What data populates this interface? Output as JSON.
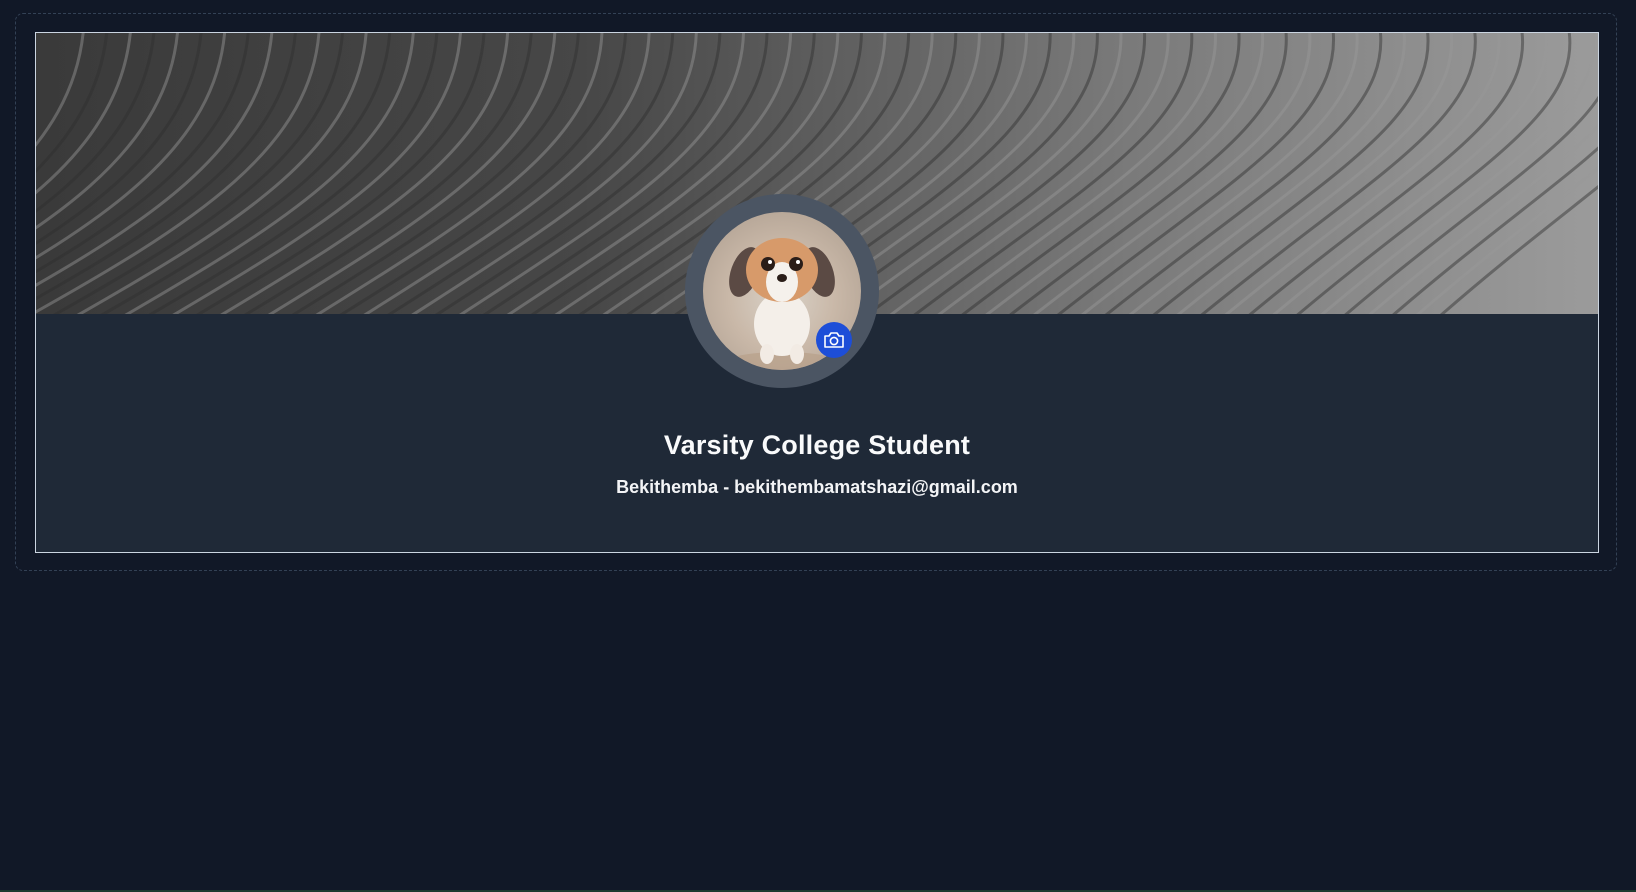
{
  "profile": {
    "title": "Varsity College Student",
    "subtitle": "Bekithemba - bekithembamatshazi@gmail.com",
    "avatar_icon": "dog-avatar-image",
    "camera_icon": "camera-icon",
    "cover_icon": "abstract-cover-image"
  },
  "colors": {
    "background": "#111827",
    "card": "#1f2937",
    "accent": "#1d4ed8"
  }
}
